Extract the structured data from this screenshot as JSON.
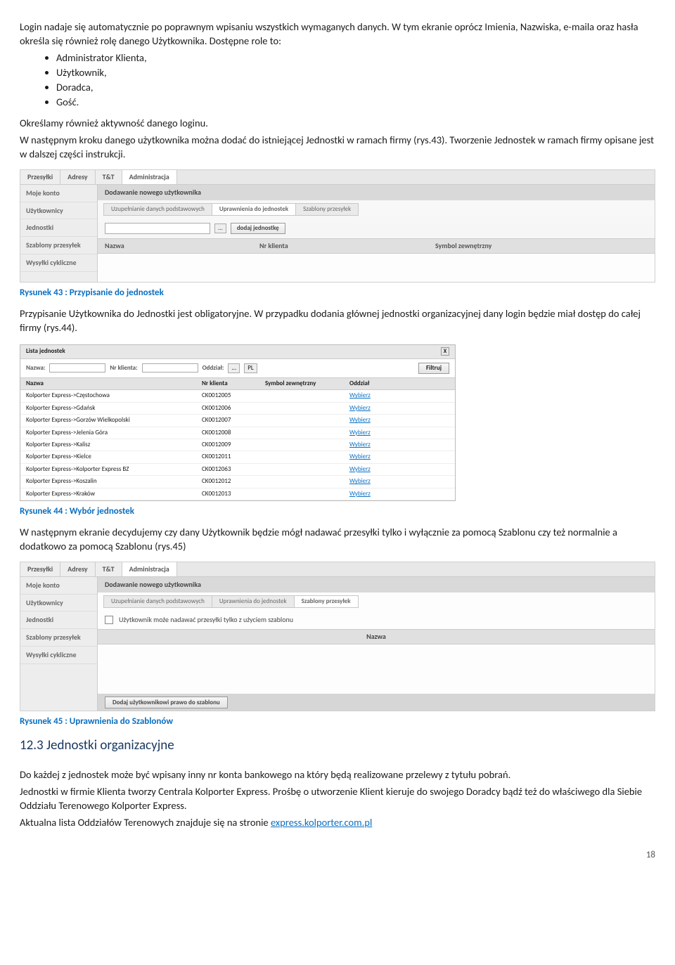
{
  "intro": {
    "p1": "Login nadaje się automatycznie po poprawnym wpisaniu wszystkich wymaganych danych. W tym ekranie oprócz Imienia, Nazwiska, e-maila oraz hasła określa się również rolę danego Użytkownika. Dostępne role to:",
    "roles": [
      "Administrator Klienta,",
      "Użytkownik,",
      "Doradca,",
      "Gość."
    ],
    "p2": "Określamy również aktywność danego loginu.",
    "p3": "W następnym kroku danego użytkownika można dodać do istniejącej Jednostki w ramach firmy (rys.43). Tworzenie Jednostek w ramach firmy opisane jest w dalszej części instrukcji."
  },
  "ss1": {
    "tabs": [
      "Przesyłki",
      "Adresy",
      "T&T",
      "Administracja"
    ],
    "side": [
      "Moje konto",
      "Użytkownicy",
      "Jednostki",
      "Szablony przesyłek",
      "Wysyłki cykliczne"
    ],
    "header": "Dodawanie nowego użytkownika",
    "steps": [
      "Uzupełnianie danych podstawowych",
      "Uprawnienia do jednostek",
      "Szablony przesyłek"
    ],
    "dots": "...",
    "addbtn": "dodaj jednostkę",
    "cols": [
      "Nazwa",
      "Nr klienta",
      "Symbol zewnętrzny"
    ]
  },
  "cap43": "Rysunek 43 : Przypisanie do jednostek",
  "mid": {
    "p1": "Przypisanie Użytkownika do Jednostki jest obligatoryjne. W przypadku dodania głównej jednostki organizacyjnej dany login będzie miał dostęp do całej firmy (rys.44)."
  },
  "ss2": {
    "title": "Lista jednostek",
    "close": "X",
    "filters": {
      "l1": "Nazwa:",
      "l2": "Nr klienta:",
      "l3": "Oddział:",
      "dots": "...",
      "pl": "PL",
      "btn": "Filtruj"
    },
    "cols": [
      "Nazwa",
      "Nr klienta",
      "Symbol zewnętrzny",
      "Oddział"
    ],
    "rows": [
      {
        "n": "Kolporter Express->Częstochowa",
        "k": "CK0012005",
        "a": "Wybierz"
      },
      {
        "n": "Kolporter Express->Gdańsk",
        "k": "CK0012006",
        "a": "Wybierz"
      },
      {
        "n": "Kolporter Express->Gorzów Wielkopolski",
        "k": "CK0012007",
        "a": "Wybierz"
      },
      {
        "n": "Kolporter Express->Jelenia Góra",
        "k": "CK0012008",
        "a": "Wybierz"
      },
      {
        "n": "Kolporter Express->Kalisz",
        "k": "CK0012009",
        "a": "Wybierz"
      },
      {
        "n": "Kolporter Express->Kielce",
        "k": "CK0012011",
        "a": "Wybierz"
      },
      {
        "n": "Kolporter Express->Kolporter Express BZ",
        "k": "CK0012063",
        "a": "Wybierz"
      },
      {
        "n": "Kolporter Express->Koszalin",
        "k": "CK0012012",
        "a": "Wybierz"
      },
      {
        "n": "Kolporter Express->Kraków",
        "k": "CK0012013",
        "a": "Wybierz"
      }
    ]
  },
  "cap44": "Rysunek 44 : Wybór jednostek",
  "mid2": {
    "p1": "W następnym ekranie decydujemy czy dany Użytkownik będzie mógł nadawać przesyłki tylko i wyłącznie za pomocą Szablonu czy też normalnie a dodatkowo za pomocą Szablonu (rys.45)"
  },
  "ss3": {
    "tabs": [
      "Przesyłki",
      "Adresy",
      "T&T",
      "Administracja"
    ],
    "side": [
      "Moje konto",
      "Użytkownicy",
      "Jednostki",
      "Szablony przesyłek",
      "Wysyłki cykliczne"
    ],
    "header": "Dodawanie nowego użytkownika",
    "steps": [
      "Uzupełnianie danych podstawowych",
      "Uprawnienia do jednostek",
      "Szablony przesyłek"
    ],
    "chk": "Użytkownik może nadawać przesyłki tylko z użyciem szablonu",
    "namecol": "Nazwa",
    "footbtn": "Dodaj użytkownikowi prawo do szablonu"
  },
  "cap45": "Rysunek 45 : Uprawnienia do Szablonów",
  "h2": "12.3 Jednostki organizacyjne",
  "outro": {
    "p1": "Do każdej z jednostek może być wpisany inny nr konta bankowego na który będą realizowane przelewy z tytułu pobrań.",
    "p2a": "Jednostki w firmie Klienta tworzy Centrala Kolporter Express. Prośbę o utworzenie Klient kieruje do swojego Doradcy bądź też do właściwego dla Siebie Oddziału Terenowego Kolporter Express.",
    "p3a": "Aktualna lista Oddziałów Terenowych znajduje się na stronie ",
    "link": "express.kolporter.com.pl"
  },
  "pagenum": "18"
}
